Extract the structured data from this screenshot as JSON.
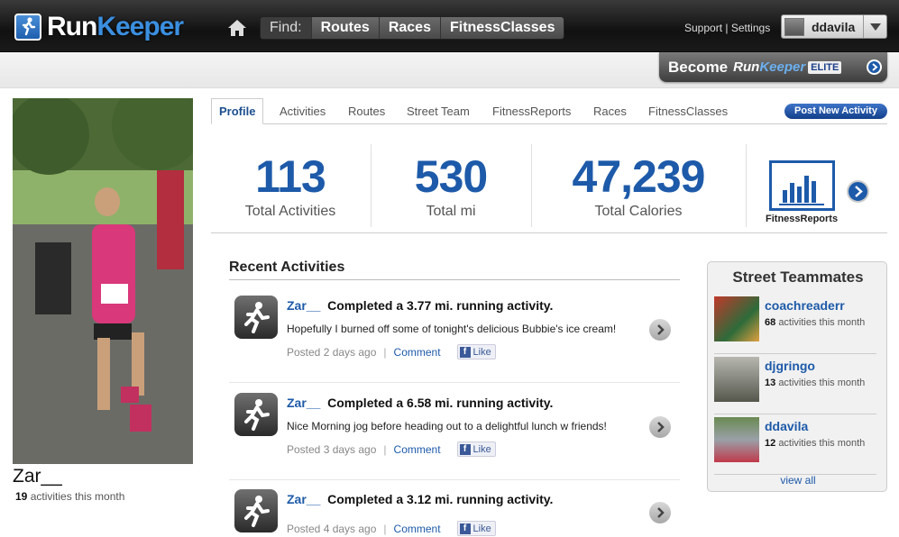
{
  "header": {
    "logo_text_run": "Run",
    "logo_text_keeper": "Keeper",
    "find_label": "Find:",
    "find_items": [
      "Routes",
      "Races",
      "FitnessClasses"
    ],
    "support": "Support",
    "settings": "Settings",
    "username": "ddavila"
  },
  "elite": {
    "become": "Become",
    "run": "Run",
    "keeper": "Keeper",
    "tag": "ELITE"
  },
  "profile": {
    "name": "Zar__",
    "activities_count": "19",
    "activities_suffix": "activities this month"
  },
  "tabs": [
    "Profile",
    "Activities",
    "Routes",
    "Street Team",
    "FitnessReports",
    "Races",
    "FitnessClasses"
  ],
  "post_button": "Post New Activity",
  "stats": [
    {
      "value": "113",
      "label": "Total Activities"
    },
    {
      "value": "530",
      "label": "Total mi"
    },
    {
      "value": "47,239",
      "label": "Total Calories"
    }
  ],
  "fitness_reports_label": "FitnessReports",
  "recent": {
    "title": "Recent Activities",
    "items": [
      {
        "user": "Zar__",
        "headline": "Completed a 3.77 mi. running activity.",
        "desc": "Hopefully I burned off some of tonight's delicious Bubbie's ice cream!",
        "posted": "Posted 2 days ago",
        "comment": "Comment",
        "like": "Like"
      },
      {
        "user": "Zar__",
        "headline": "Completed a 6.58 mi. running activity.",
        "desc": "Nice Morning jog before heading out to a delightful lunch w friends!",
        "posted": "Posted 3 days ago",
        "comment": "Comment",
        "like": "Like"
      },
      {
        "user": "Zar__",
        "headline": "Completed a 3.12 mi. running activity.",
        "desc": "",
        "posted": "Posted 4 days ago",
        "comment": "Comment",
        "like": "Like"
      }
    ]
  },
  "teammates": {
    "title": "Street Teammates",
    "items": [
      {
        "name": "coachreaderr",
        "count": "68",
        "suffix": "activities this month"
      },
      {
        "name": "djgringo",
        "count": "13",
        "suffix": "activities this month"
      },
      {
        "name": "ddavila",
        "count": "12",
        "suffix": "activities this month"
      }
    ],
    "view_all": "view all"
  },
  "colors": {
    "brand_blue": "#1d5aa9",
    "top_bar": "#1a1a1a"
  }
}
